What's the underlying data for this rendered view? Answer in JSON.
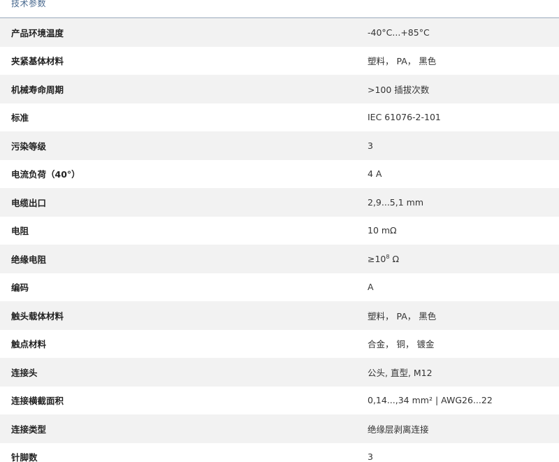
{
  "section": {
    "title": "技术参数"
  },
  "rows": [
    {
      "label": "产品环境温度",
      "value": "-40°C...+85°C"
    },
    {
      "label": "夹紧基体材料",
      "value": "塑料， PA， 黑色"
    },
    {
      "label": "机械寿命周期",
      "value": ">100 插拔次数"
    },
    {
      "label": "标准",
      "value": "IEC 61076-2-101"
    },
    {
      "label": "污染等级",
      "value": "3"
    },
    {
      "label": "电流负荷（40°）",
      "value": "4 A"
    },
    {
      "label": "电缆出口",
      "value": "2,9...5,1 mm"
    },
    {
      "label": "电阻",
      "value": "10 mΩ"
    },
    {
      "label": "绝缘电阻",
      "value_prefix": "≥10",
      "value_sup": "8",
      "value_suffix": " Ω"
    },
    {
      "label": "编码",
      "value": "A"
    },
    {
      "label": "触头载体材料",
      "value": "塑料， PA， 黑色"
    },
    {
      "label": "触点材料",
      "value": "合金， 铜， 镀金"
    },
    {
      "label": "连接头",
      "value": "公头, 直型, M12"
    },
    {
      "label": "连接横截面积",
      "value": "0,14...,34 mm² | AWG26...22"
    },
    {
      "label": "连接类型",
      "value": "绝缘层剥离连接"
    },
    {
      "label": "针脚数",
      "value": "3"
    }
  ]
}
